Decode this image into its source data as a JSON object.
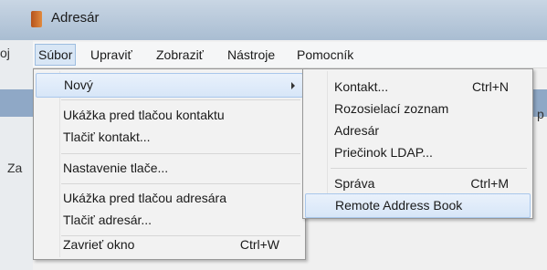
{
  "window": {
    "title": "Adresár"
  },
  "background": {
    "left_text_1": "oj",
    "left_text_2": "Za",
    "right_text": "p"
  },
  "menubar": {
    "items": [
      {
        "label": "Súbor"
      },
      {
        "label": "Upraviť"
      },
      {
        "label": "Zobraziť"
      },
      {
        "label": "Nástroje"
      },
      {
        "label": "Pomocník"
      }
    ]
  },
  "file_menu": {
    "items": [
      {
        "label": "Nový",
        "shortcut": ""
      },
      {
        "label": "Ukážka pred tlačou kontaktu",
        "shortcut": ""
      },
      {
        "label": "Tlačiť kontakt...",
        "shortcut": ""
      },
      {
        "label": "Nastavenie tlače...",
        "shortcut": ""
      },
      {
        "label": "Ukážka pred tlačou adresára",
        "shortcut": ""
      },
      {
        "label": "Tlačiť adresár...",
        "shortcut": ""
      },
      {
        "label": "Zavrieť okno",
        "shortcut": "Ctrl+W"
      }
    ]
  },
  "new_submenu": {
    "items": [
      {
        "label": "Kontakt...",
        "shortcut": "Ctrl+N"
      },
      {
        "label": "Rozosielací zoznam",
        "shortcut": ""
      },
      {
        "label": "Adresár",
        "shortcut": ""
      },
      {
        "label": "Priečinok LDAP...",
        "shortcut": ""
      },
      {
        "label": "Správa",
        "shortcut": "Ctrl+M"
      },
      {
        "label": "Remote Address Book",
        "shortcut": ""
      }
    ]
  }
}
